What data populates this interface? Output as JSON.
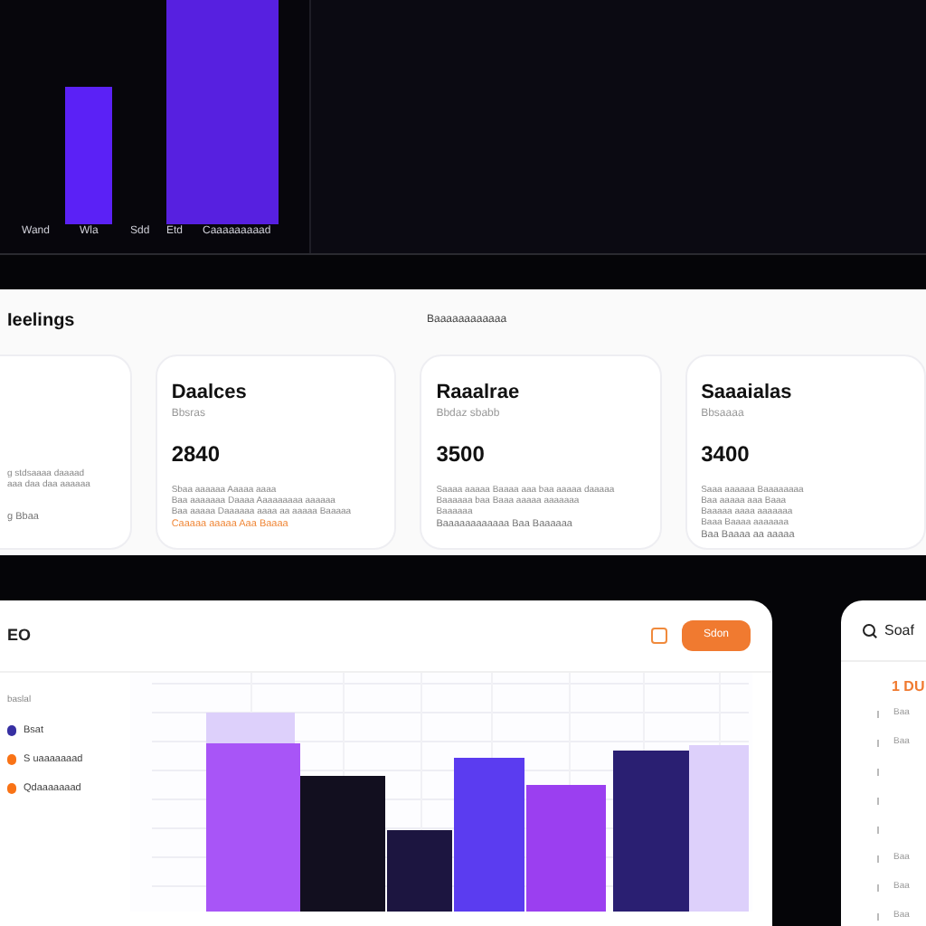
{
  "top_chart": {
    "labels": [
      "Wand",
      "Wla",
      "Sdd",
      "Etd",
      "Caaaaaaaaad"
    ]
  },
  "summary": {
    "title": "Ieelings",
    "subtitle": "Baaaaaaaaaaaa",
    "cards": [
      {
        "lines": [
          "g stdsaaaa daaaad",
          "aaa daa daa aaaaaa"
        ],
        "footer": "g Bbaa",
        "footer_accent": false
      },
      {
        "title": "Daalces",
        "subtitle": "Bbsras",
        "value": "2840",
        "lines": [
          "Sbaa aaaaaa Aaaaa aaaa",
          "Baa aaaaaaa Daaaa Aaaaaaaaa aaaaaa",
          "Baa aaaaa Daaaaaa aaaa aa aaaaa Baaaaa"
        ],
        "footer": "Caaaaa aaaaa Aaa Baaaa",
        "footer_accent": true
      },
      {
        "title": "Raaalrae",
        "subtitle": "Bbdaz sbabb",
        "value": "3500",
        "lines": [
          "Saaaa aaaaa Baaaa aaa baa aaaaa daaaaa",
          "Baaaaaa baa Baaa aaaaa aaaaaaa",
          "Baaaaaa"
        ],
        "footer": "Baaaaaaaaaaaa Baa Baaaaaa",
        "footer_accent": false
      },
      {
        "title": "Saaaialas",
        "subtitle": "Bbsaaaa",
        "value": "3400",
        "lines": [
          "Saaa aaaaaa Baaaaaaaa",
          "Baa aaaaa aaa Baaa",
          "Baaaaa aaaa aaaaaaa",
          "Baaa Baaaa aaaaaaa"
        ],
        "footer": "Baa Baaaa aa aaaaa",
        "footer_accent": false
      }
    ]
  },
  "chart_card": {
    "title": "EO",
    "button": "Sdon",
    "legend_title": "baslal",
    "legend": [
      {
        "label": "Bsat",
        "color": "#3730a3"
      },
      {
        "label": "S uaaaaaaad",
        "color": "#f97316"
      },
      {
        "label": "Qdaaaaaaad",
        "color": "#f97316"
      }
    ]
  },
  "side_card": {
    "title": "Soaf",
    "heading": "1 DU",
    "rows": [
      {
        "kind": "text",
        "text": "Baa"
      },
      {
        "kind": "text",
        "text": "Baa"
      },
      {
        "kind": "marker"
      },
      {
        "kind": "marker"
      },
      {
        "kind": "marker"
      },
      {
        "kind": "text",
        "text": "Baa"
      },
      {
        "kind": "text",
        "text": "Baa"
      },
      {
        "kind": "text",
        "text": "Baa"
      }
    ]
  }
}
